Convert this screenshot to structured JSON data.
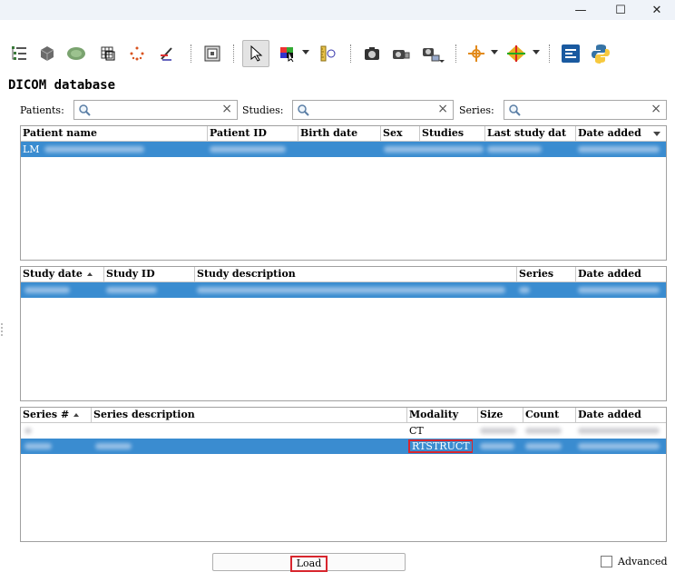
{
  "window": {
    "minimize": "—",
    "maximize": "☐",
    "close": "✕"
  },
  "toolbar": {
    "icons": [
      "data-icon",
      "volume-rendering-icon",
      "models-icon",
      "segment-editor-icon",
      "markups-icon",
      "transforms-icon",
      "layout-icon",
      "pointer-icon",
      "window-level-icon",
      "crosshair-ruler-icon",
      "screenshot-icon",
      "scene-view-icon",
      "capture-icon",
      "crosshair-icon",
      "slice-intersection-icon",
      "extension-icon",
      "python-icon"
    ]
  },
  "heading": "DICOM database",
  "filters": {
    "patients_label": "Patients:",
    "studies_label": "Studies:",
    "series_label": "Series:",
    "patients_value": "",
    "studies_value": "",
    "series_value": ""
  },
  "patients_table": {
    "columns": [
      "Patient name",
      "Patient ID",
      "Birth date",
      "Sex",
      "Studies",
      "Last study dat",
      "Date added"
    ],
    "rows": [
      {
        "name": "LM"
      }
    ]
  },
  "studies_table": {
    "columns": [
      "Study date",
      "Study ID",
      "Study description",
      "Series",
      "Date added"
    ]
  },
  "series_table": {
    "columns": [
      "Series #",
      "Series description",
      "Modality",
      "Size",
      "Count",
      "Date added"
    ],
    "rows": [
      {
        "modality": "CT"
      },
      {
        "modality": "RTSTRUCT"
      }
    ]
  },
  "load_button": "Load",
  "advanced_label": "Advanced",
  "colors": {
    "selection": "#3a8cd0",
    "highlight": "#d8262e"
  }
}
